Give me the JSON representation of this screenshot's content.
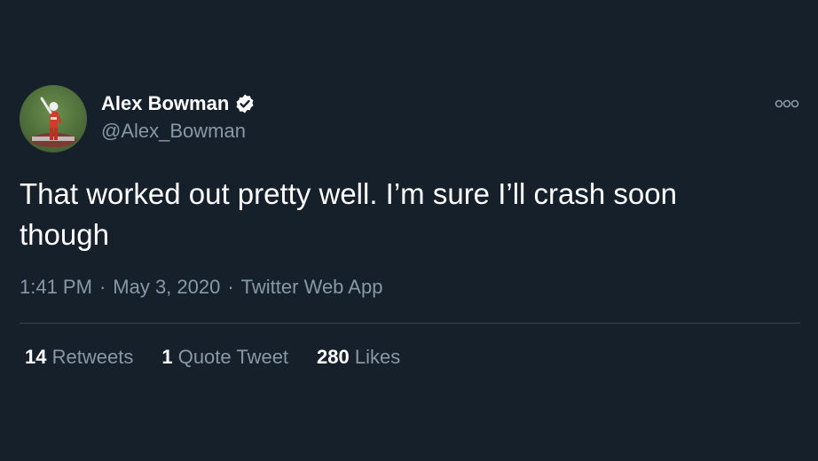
{
  "colors": {
    "background": "#15202b",
    "text_primary": "#ffffff",
    "text_secondary": "#8899a6",
    "divider": "#38444d"
  },
  "author": {
    "display_name": "Alex Bowman",
    "handle": "@Alex_Bowman",
    "verified": true,
    "verified_icon": "verified-badge-icon",
    "avatar_icon": "avatar"
  },
  "more_icon": "more-options-icon",
  "tweet": {
    "text": "That worked out pretty well. I’m sure I’ll crash soon though"
  },
  "meta": {
    "time": "1:41 PM",
    "separator1": "·",
    "date": "May 3, 2020",
    "separator2": "·",
    "source": "Twitter Web App"
  },
  "stats": {
    "retweets": {
      "count": "14",
      "label": "Retweets"
    },
    "quote_tweets": {
      "count": "1",
      "label": "Quote Tweet"
    },
    "likes": {
      "count": "280",
      "label": "Likes"
    }
  }
}
